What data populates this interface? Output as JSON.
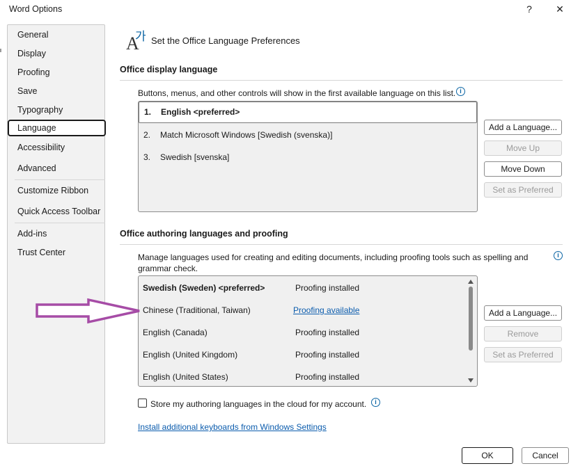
{
  "window": {
    "title": "Word Options",
    "help_glyph": "?",
    "close_glyph": "✕"
  },
  "sidebar": {
    "items": [
      {
        "label": "General"
      },
      {
        "label": "Display"
      },
      {
        "label": "Proofing"
      },
      {
        "label": "Save"
      },
      {
        "label": "Typography"
      },
      {
        "label": "Language"
      },
      {
        "label": "Accessibility"
      },
      {
        "label": "Advanced"
      },
      {
        "label": "Customize Ribbon"
      },
      {
        "label": "Quick Access Toolbar"
      },
      {
        "label": "Add-ins"
      },
      {
        "label": "Trust Center"
      }
    ],
    "selected": "Language"
  },
  "header": {
    "icon_a": "A",
    "icon_ko": "가",
    "title": "Set the Office Language Preferences"
  },
  "display_language": {
    "section_title": "Office display language",
    "description": "Buttons, menus, and other controls will show in the first available language on this list.",
    "list": [
      {
        "num": "1.",
        "label": "English <preferred>"
      },
      {
        "num": "2.",
        "label": "Match Microsoft Windows [Swedish (svenska)]"
      },
      {
        "num": "3.",
        "label": "Swedish [svenska]"
      }
    ],
    "buttons": {
      "add": "Add a Language...",
      "move_up": "Move Up",
      "move_down": "Move Down",
      "set_preferred": "Set as Preferred"
    }
  },
  "authoring": {
    "section_title": "Office authoring languages and proofing",
    "description": "Manage languages used for creating and editing documents, including proofing tools such as spelling and grammar check.",
    "list": [
      {
        "language": "Swedish (Sweden) <preferred>",
        "status": "Proofing installed"
      },
      {
        "language": "Chinese (Traditional, Taiwan)",
        "status": "Proofing available"
      },
      {
        "language": "English (Canada)",
        "status": "Proofing installed"
      },
      {
        "language": "English (United Kingdom)",
        "status": "Proofing installed"
      },
      {
        "language": "English (United States)",
        "status": "Proofing installed"
      }
    ],
    "buttons": {
      "add": "Add a Language...",
      "remove": "Remove",
      "set_preferred": "Set as Preferred"
    },
    "cloud_checkbox": {
      "label": "Store my authoring languages in the cloud for my account.",
      "checked": false
    },
    "keyboards_link": "Install additional keyboards from Windows Settings"
  },
  "footer": {
    "ok": "OK",
    "cancel": "Cancel"
  },
  "colors": {
    "accent_link": "#0b5cad",
    "annotation_arrow": "#a64ca6",
    "info_icon": "#0a64a4"
  },
  "icons": {
    "help": "question-mark-icon",
    "close": "close-icon",
    "language": "language-icon",
    "info": "info-icon"
  }
}
